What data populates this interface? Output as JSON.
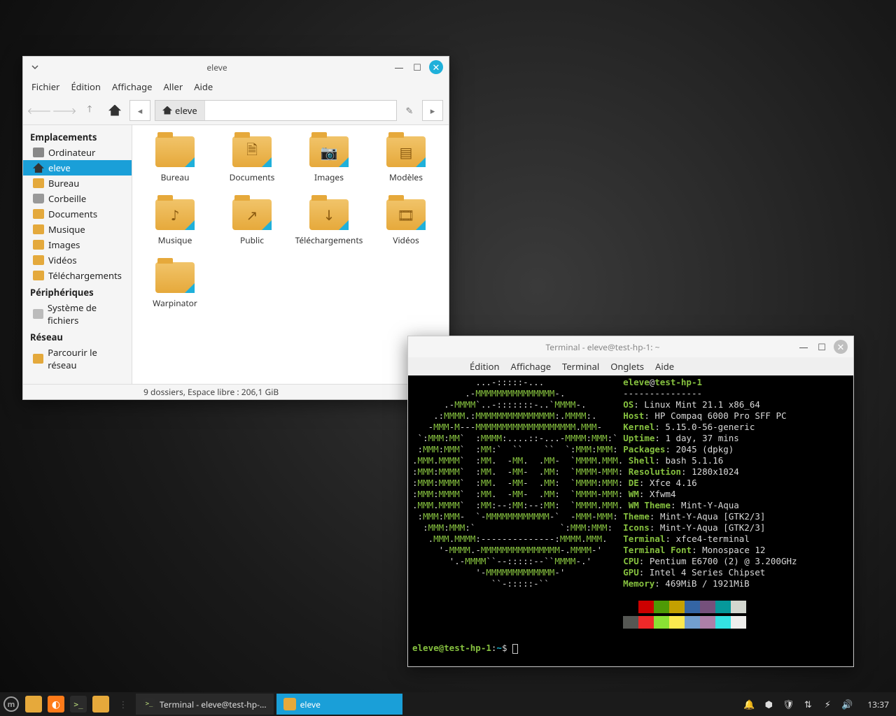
{
  "filemanager": {
    "title": "eleve",
    "menus": [
      "Fichier",
      "Édition",
      "Affichage",
      "Aller",
      "Aide"
    ],
    "path_segment": "eleve",
    "sidebar": {
      "places_hdr": "Emplacements",
      "devices_hdr": "Périphériques",
      "network_hdr": "Réseau",
      "items": [
        {
          "label": "Ordinateur",
          "ic": "computer"
        },
        {
          "label": "eleve",
          "ic": "home",
          "active": true
        },
        {
          "label": "Bureau",
          "ic": "folder"
        },
        {
          "label": "Corbeille",
          "ic": "trash"
        },
        {
          "label": "Documents",
          "ic": "folder"
        },
        {
          "label": "Musique",
          "ic": "folder"
        },
        {
          "label": "Images",
          "ic": "folder"
        },
        {
          "label": "Vidéos",
          "ic": "folder"
        },
        {
          "label": "Téléchargements",
          "ic": "folder"
        }
      ],
      "devices": [
        {
          "label": "Système de fichiers",
          "ic": "fs"
        }
      ],
      "network": [
        {
          "label": "Parcourir le réseau",
          "ic": "net"
        }
      ]
    },
    "folders": [
      {
        "label": "Bureau",
        "glyph": ""
      },
      {
        "label": "Documents",
        "glyph": "🗎"
      },
      {
        "label": "Images",
        "glyph": "📷"
      },
      {
        "label": "Modèles",
        "glyph": "▤"
      },
      {
        "label": "Musique",
        "glyph": "♪"
      },
      {
        "label": "Public",
        "glyph": "↗"
      },
      {
        "label": "Téléchargements",
        "glyph": "↓"
      },
      {
        "label": "Vidéos",
        "glyph": "🎞"
      },
      {
        "label": "Warpinator",
        "glyph": ""
      }
    ],
    "status": "9 dossiers, Espace libre : 206,1 GiB"
  },
  "terminal": {
    "title": "Terminal - eleve@test-hp-1: ~",
    "menus": [
      "Édition",
      "Affichage",
      "Terminal",
      "Onglets",
      "Aide"
    ],
    "neofetch": {
      "user": "eleve",
      "at": "@",
      "host": "test-hp-1",
      "dashes": "---------------",
      "fields": [
        {
          "k": "OS",
          "v": "Linux Mint 21.1 x86_64"
        },
        {
          "k": "Host",
          "v": "HP Compaq 6000 Pro SFF PC"
        },
        {
          "k": "Kernel",
          "v": "5.15.0-56-generic"
        },
        {
          "k": "Uptime",
          "v": "1 day, 37 mins"
        },
        {
          "k": "Packages",
          "v": "2045 (dpkg)"
        },
        {
          "k": "Shell",
          "v": "bash 5.1.16"
        },
        {
          "k": "Resolution",
          "v": "1280x1024"
        },
        {
          "k": "DE",
          "v": "Xfce 4.16"
        },
        {
          "k": "WM",
          "v": "Xfwm4"
        },
        {
          "k": "WM Theme",
          "v": "Mint-Y-Aqua"
        },
        {
          "k": "Theme",
          "v": "Mint-Y-Aqua [GTK2/3]"
        },
        {
          "k": "Icons",
          "v": "Mint-Y-Aqua [GTK2/3]"
        },
        {
          "k": "Terminal",
          "v": "xfce4-terminal"
        },
        {
          "k": "Terminal Font",
          "v": "Monospace 12"
        },
        {
          "k": "CPU",
          "v": "Pentium E6700 (2) @ 3.200GHz"
        },
        {
          "k": "GPU",
          "v": "Intel 4 Series Chipset"
        },
        {
          "k": "Memory",
          "v": "469MiB / 1921MiB"
        }
      ],
      "palette": [
        "#000000",
        "#cc0000",
        "#4e9a06",
        "#c4a000",
        "#3465a4",
        "#75507b",
        "#06989a",
        "#d3d7cf",
        "#555753",
        "#ef2929",
        "#8ae234",
        "#fce94f",
        "#729fcf",
        "#ad7fa8",
        "#34e2e2",
        "#eeeeec"
      ]
    },
    "prompt": {
      "user": "eleve",
      "host": "test-hp-1",
      "path": "~",
      "sym": "$"
    },
    "ascii": "            ...-:::::-...\n          .-MMMMMMMMMMMMMMM-.\n      .-MMMM`..-:::::::-..`MMMM-.\n    .:MMMM.:MMMMMMMMMMMMMMM:.MMMM:.\n   -MMM-M---MMMMMMMMMMMMMMMMMMM.MMM-\n `:MMM:MM`  :MMMM:....::-...-MMMM:MMM:`\n :MMM:MMM`  :MM:`  ``    ``  `:MMM:MMM:\n.MMM.MMMM`  :MM.  -MM.  .MM-  `MMMM.MMM.\n:MMM:MMMM`  :MM.  -MM-  .MM:  `MMMM-MMM:\n:MMM:MMMM`  :MM.  -MM-  .MM:  `MMMM:MMM:\n:MMM:MMMM`  :MM.  -MM-  .MM:  `MMMM-MMM:\n.MMM.MMMM`  :MM:--:MM:--:MM:  `MMMM.MMM.\n :MMM:MMM-  `-MMMMMMMMMMMM-`  -MMM-MMM:\n  :MMM:MMM:`                `:MMM:MMM:\n   .MMM.MMMM:--------------:MMMM.MMM.\n     '-MMMM.-MMMMMMMMMMMMMMM-.MMMM-'\n       '.-MMMM``--:::::--``MMMM-.'\n            '-MMMMMMMMMMMMM-'\n               ``-:::::-``"
  },
  "panel": {
    "tasks": [
      {
        "label": "Terminal - eleve@test-hp-...",
        "icon": "terminal",
        "active": false
      },
      {
        "label": "eleve",
        "icon": "files",
        "active": true
      }
    ],
    "clock": "13:37"
  }
}
